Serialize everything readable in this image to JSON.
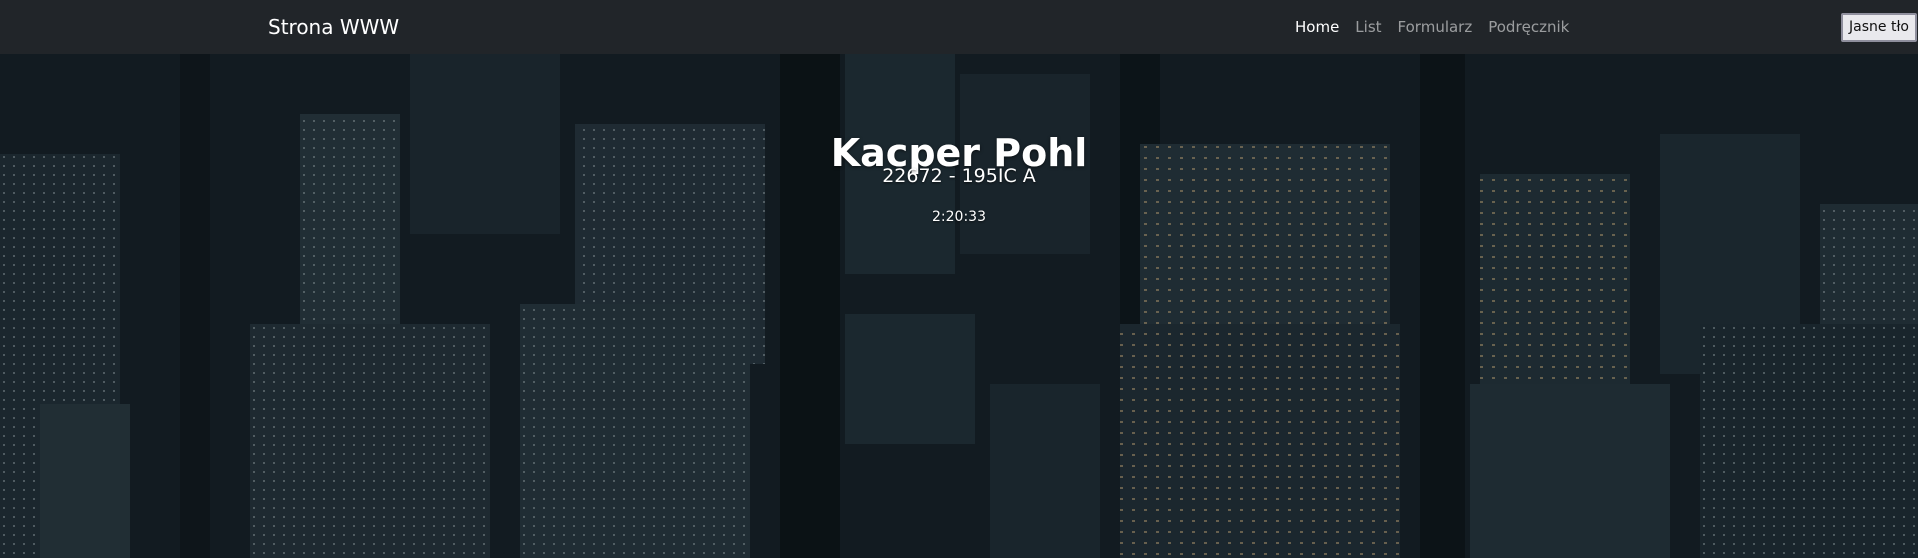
{
  "navbar": {
    "brand": "Strona WWW",
    "links": [
      {
        "label": "Home",
        "active": true
      },
      {
        "label": "List",
        "active": false
      },
      {
        "label": "Formularz",
        "active": false
      },
      {
        "label": "Podręcznik",
        "active": false
      }
    ],
    "theme_button": "Jasne tło"
  },
  "hero": {
    "title": "Kacper Pohl",
    "subtitle": "22672 - 195IC A",
    "clock": "2:20:33"
  },
  "colors": {
    "navbar_bg": "#212529",
    "nav_active": "#ffffff",
    "nav_inactive": "#8c8f93",
    "hero_tint": "#1b2a33"
  }
}
